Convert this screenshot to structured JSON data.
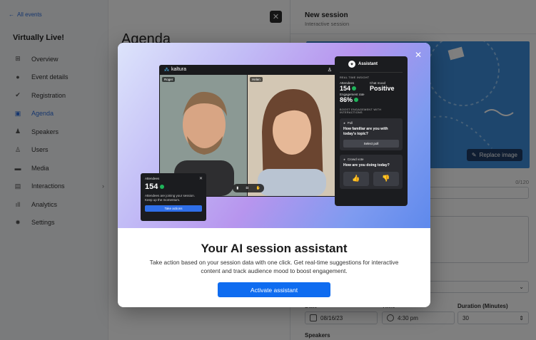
{
  "sidebar": {
    "back_label": "All events",
    "event_name": "Virtually Live!",
    "items": [
      {
        "label": "Overview"
      },
      {
        "label": "Event details"
      },
      {
        "label": "Registration"
      },
      {
        "label": "Agenda",
        "active": true
      },
      {
        "label": "Speakers"
      },
      {
        "label": "Users"
      },
      {
        "label": "Media"
      },
      {
        "label": "Interactions",
        "has_submenu": true
      },
      {
        "label": "Analytics"
      },
      {
        "label": "Settings"
      }
    ]
  },
  "main": {
    "title": "Agenda"
  },
  "panel": {
    "title": "New session",
    "subtitle": "Interactive session",
    "replace_image_label": "Replace image",
    "name_counter": "0/120",
    "date_label": "Date",
    "date_value": "08/16/23",
    "time_label": "Time",
    "time_value": "4:30 pm",
    "duration_label": "Duration (Minutes)",
    "duration_value": "30",
    "speakers_label": "Speakers"
  },
  "modal": {
    "title": "Your AI session assistant",
    "description": "Take action based on your session data with one click. Get real-time suggestions for interactive content and track audience mood to boost engagement.",
    "cta_label": "Activate assistant",
    "illustration": {
      "app_name": "kaltura",
      "tile_a_name": "Roger",
      "tile_b_name": "Helen",
      "assistant": {
        "title": "Assistant",
        "section_insight": "REAL TIME INSIGHT",
        "attendees_label": "Attendees",
        "attendees_value": "154",
        "chat_mood_label": "Chat mood",
        "chat_mood_value": "Positive",
        "engagement_label": "Engagement rate",
        "engagement_value": "86%",
        "section_boost": "BOOST ENGAGEMENT WITH INTERACTIONS",
        "poll_label": "Poll",
        "poll_question": "How familiar are you with today's topic?",
        "poll_button": "Select poll",
        "crowd_label": "Crowd vote",
        "crowd_question": "How are you doing today?"
      },
      "attendees_card": {
        "label": "Attendees",
        "value": "154",
        "text": "Attendees are joining your session. Keep up the momentum.",
        "button": "Take actions"
      }
    }
  },
  "colors": {
    "accent": "#0f6cf0",
    "positive": "#1fb45a"
  }
}
